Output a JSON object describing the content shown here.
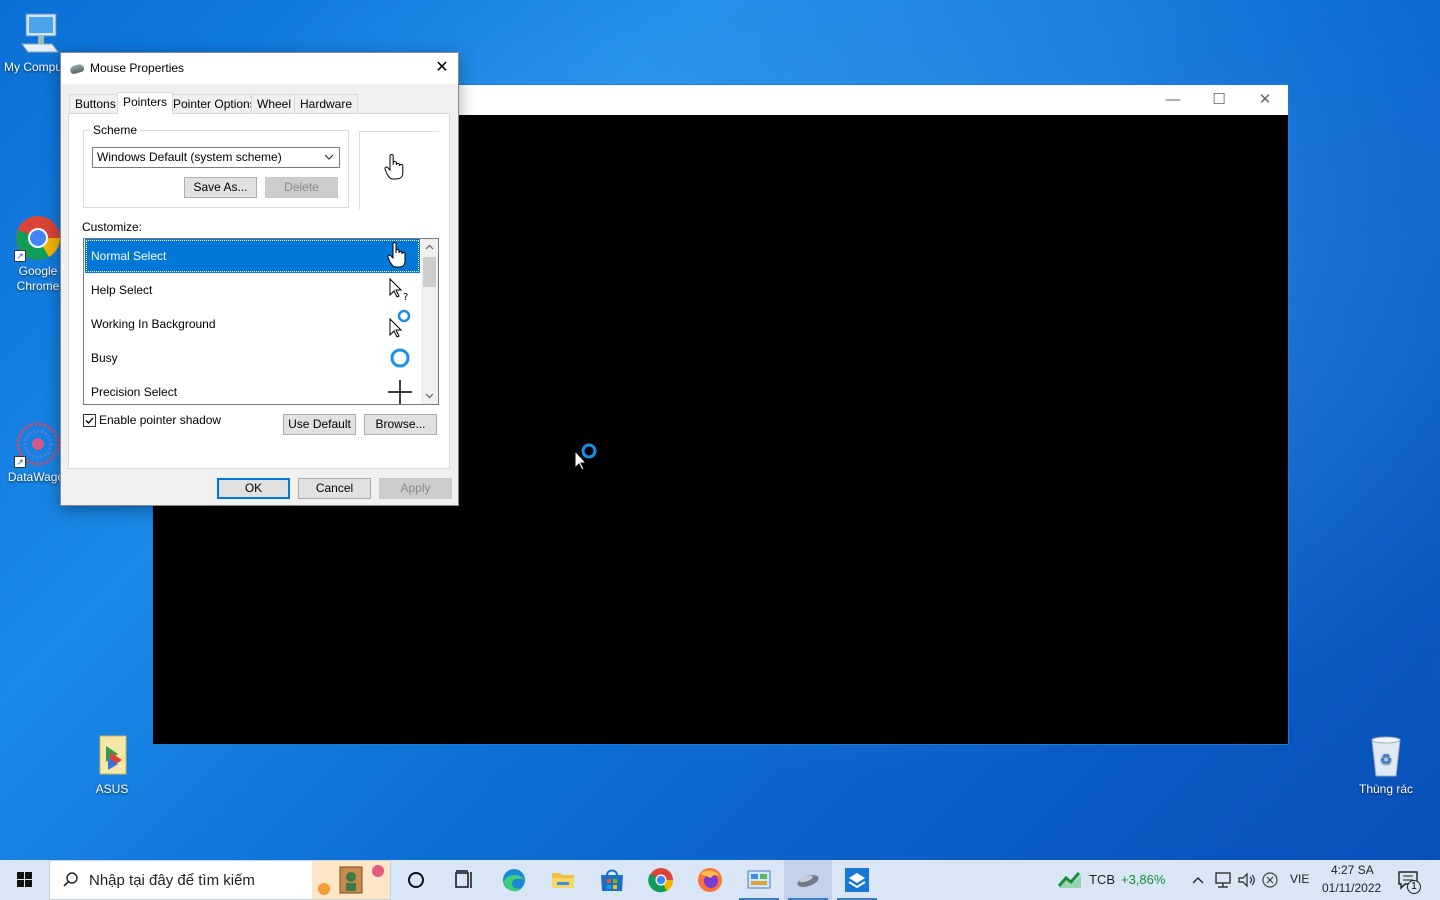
{
  "desktop": {
    "icons": [
      {
        "label": "My Compute",
        "icon": "computer-icon"
      },
      {
        "label": "Google Chrome",
        "icon": "chrome-icon"
      },
      {
        "label": "DataWagor",
        "icon": "datawagon-icon"
      },
      {
        "label": "ASUS",
        "icon": "asus-folder-icon"
      },
      {
        "label": "Thùng rác",
        "icon": "recycle-bin-icon"
      }
    ]
  },
  "black_window": {
    "minimize": "—",
    "maximize": "☐",
    "close": "✕"
  },
  "dialog": {
    "title": "Mouse Properties",
    "close_glyph": "✕",
    "tabs": [
      "Buttons",
      "Pointers",
      "Pointer Options",
      "Wheel",
      "Hardware"
    ],
    "active_tab": "Pointers",
    "scheme": {
      "label": "Scheme",
      "selected": "Windows Default (system scheme)",
      "save_as": "Save As...",
      "delete": "Delete"
    },
    "customize_label": "Customize:",
    "cursors": [
      {
        "label": "Normal Select",
        "icon": "hand-pointer-icon",
        "selected": true
      },
      {
        "label": "Help Select",
        "icon": "help-select-icon",
        "selected": false
      },
      {
        "label": "Working In Background",
        "icon": "working-background-icon",
        "selected": false
      },
      {
        "label": "Busy",
        "icon": "busy-ring-icon",
        "selected": false
      },
      {
        "label": "Precision Select",
        "icon": "crosshair-icon",
        "selected": false
      }
    ],
    "enable_shadow": {
      "label": "Enable pointer shadow",
      "checked": true
    },
    "use_default": "Use Default",
    "browse": "Browse...",
    "ok": "OK",
    "cancel": "Cancel",
    "apply": "Apply"
  },
  "taskbar": {
    "search_placeholder": "Nhập tại đây để tìm kiếm",
    "apps": [
      "cortana-icon",
      "task-view-icon",
      "edge-icon",
      "file-explorer-icon",
      "store-icon",
      "chrome-icon",
      "firefox-icon",
      "control-panel-icon",
      "mouse-icon",
      "app-icon"
    ],
    "stock": {
      "symbol": "TCB",
      "change": "+3,86%",
      "color": "#1a8a3a"
    },
    "language": "VIE",
    "time": "4:27 SA",
    "date": "01/11/2022",
    "notification_count": "1"
  },
  "colors": {
    "accent": "#0078d7",
    "wallpaper": "#0d6ed5"
  }
}
